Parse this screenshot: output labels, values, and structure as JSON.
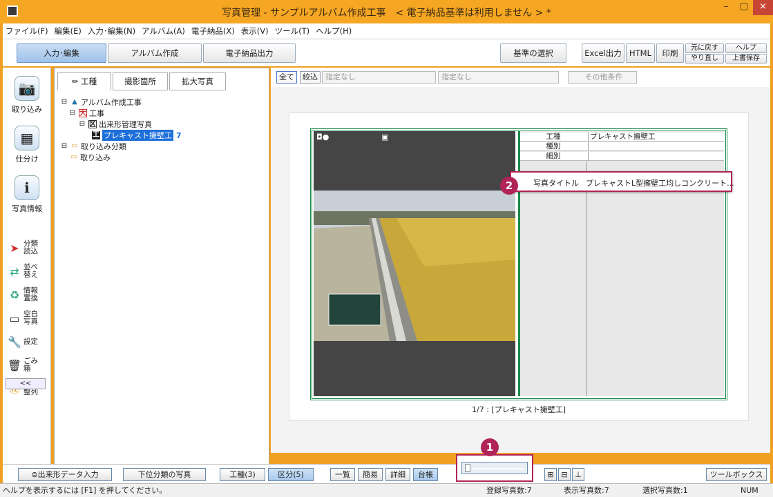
{
  "window": {
    "title": "写真管理 - サンプルアルバム作成工事　< 電子納品基準は利用しません > *",
    "min": "–",
    "max": "□",
    "close": "×"
  },
  "menu": [
    "ファイル(F)",
    "編集(E)",
    "入力･編集(N)",
    "アルバム(A)",
    "電子納品(X)",
    "表示(V)",
    "ツール(T)",
    "ヘルプ(H)"
  ],
  "toolbar": {
    "modes": [
      "入力･編集",
      "アルバム作成",
      "電子納品出力"
    ],
    "kijun": "基準の選択",
    "excel": "Excel出力",
    "html": "HTML",
    "print": "印刷",
    "undo": "元に戻す",
    "redo": "やり直し",
    "help": "ヘルプ",
    "overwrite": "上書保存"
  },
  "sidebar": {
    "big": [
      "取り込み",
      "仕分け",
      "写真情報"
    ],
    "small": [
      "分類読込",
      "並べ替え",
      "情報置換",
      "空白写真",
      "設定",
      "ごみ箱",
      "番号整列"
    ],
    "collapse": "<<"
  },
  "tree": {
    "tabs": [
      "工種",
      "撮影箇所",
      "拡大写真"
    ],
    "root": "アルバム作成工事",
    "n1": "工事",
    "n1_badge": "大",
    "n2": "出来形管理写真",
    "n2_badge": "区",
    "n3": "プレキャスト擁壁工",
    "n3_badge": "工",
    "n3_count": "7",
    "r2": "取り込み分類",
    "r2c": "取り込み"
  },
  "filter": {
    "all": "全て",
    "narrow": "絞込",
    "sel1": "指定なし",
    "sel2": "指定なし",
    "other": "その他条件"
  },
  "info": {
    "rows": [
      {
        "k": "工種",
        "v": "プレキャスト擁壁工"
      },
      {
        "k": "種別",
        "v": ""
      },
      {
        "k": "細別",
        "v": ""
      }
    ],
    "highlight_k": "写真タイトル",
    "highlight_v": "プレキャストL型擁壁工均しコンクリート..."
  },
  "markers": {
    "m1": "1",
    "m2": "2"
  },
  "caption": "1/7 : [プレキャスト擁壁工]",
  "bottom": {
    "dekigata": "出来形データ入力",
    "kai": "下位分類の写真",
    "koshu": "工種(3)",
    "kubun": "区分(5)",
    "ichiran": "一覧",
    "kani": "簡易",
    "shosai": "詳細",
    "daicho": "台帳",
    "toolbox": "ツールボックス"
  },
  "status": {
    "help": "ヘルプを表示するには [F1] を押してください。",
    "registered": "登録写真数:7",
    "shown": "表示写真数:7",
    "selected": "選択写真数:1",
    "num": "NUM"
  },
  "colors": {
    "accent": "#f5a623",
    "frame": "#1a8a4a",
    "marker": "#b02457"
  }
}
